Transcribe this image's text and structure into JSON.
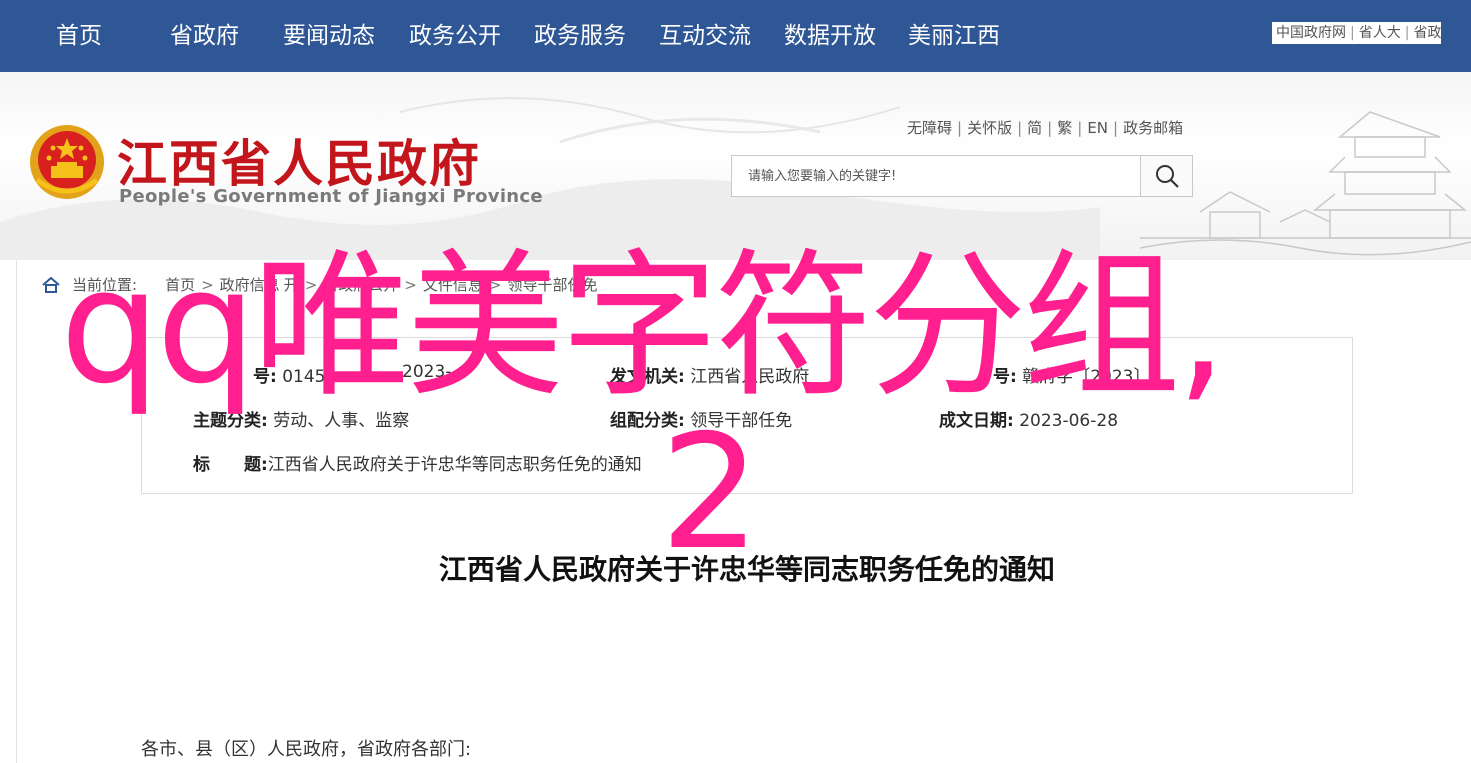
{
  "nav": {
    "items": [
      "首页",
      "省政府",
      "要闻动态",
      "政务公开",
      "政务服务",
      "互动交流",
      "数据开放",
      "美丽江西"
    ]
  },
  "top_links": [
    "中国政府网",
    "省人大",
    "省政"
  ],
  "header": {
    "title": "江西省人民政府",
    "subtitle": "People's Government of Jiangxi Province",
    "utility_links": [
      "无障碍",
      "关怀版",
      "简",
      "繁",
      "EN",
      "政务邮箱"
    ],
    "search_placeholder": "请输入您要输入的关键字!"
  },
  "breadcrumb": {
    "label": "当前位置:",
    "items": [
      "首页",
      "政府信息",
      "开",
      "省政府公开",
      "文件信息",
      "领导干部任免"
    ]
  },
  "info": {
    "row1": {
      "c1_label": "号:",
      "c1_value": "0145",
      "c1_tail": "2023-",
      "c2_label": "发文机关:",
      "c2_value": "江西省人民政府",
      "c3_label": "号:",
      "c3_value": "赣府字〔2023〕"
    },
    "row2": {
      "c1_label": "主题分类:",
      "c1_value": "劳动、人事、监察",
      "c2_label": "组配分类:",
      "c2_value": "领导干部任免",
      "c3_label": "成文日期:",
      "c3_value": "2023-06-28"
    },
    "row3": {
      "label_a": "标",
      "label_b": "题:",
      "value": "江西省人民政府关于许忠华等同志职务任免的通知"
    }
  },
  "document": {
    "title": "江西省人民政府关于许忠华等同志职务任免的通知",
    "greeting": "各市、县（区）人民政府，省政府各部门:"
  },
  "watermark": {
    "line1": "qq唯美字符分组,",
    "line2": "2",
    "color": "#ff1f8e"
  },
  "colors": {
    "nav_bg": "#2f5695",
    "title_red": "#c3161c"
  }
}
